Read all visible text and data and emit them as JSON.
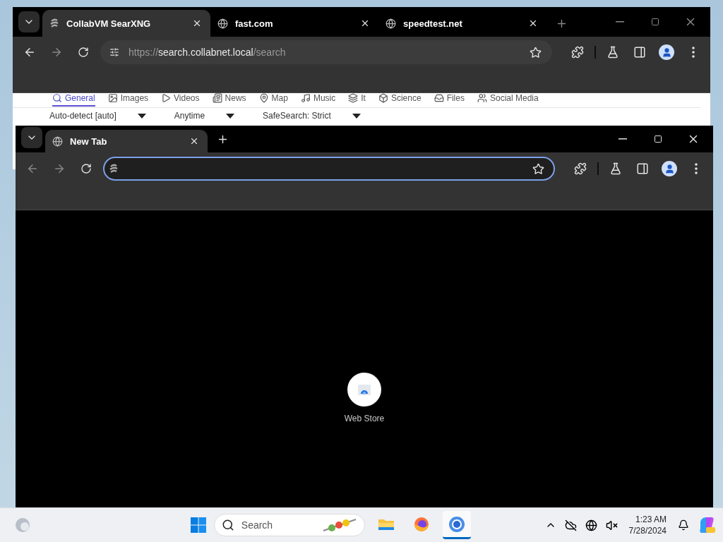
{
  "windows": [
    {
      "active": false,
      "tabs": [
        {
          "title": "CollabVM SearXNG",
          "kind": "site",
          "selected": true
        },
        {
          "title": "fast.com",
          "kind": "globe",
          "selected": false
        },
        {
          "title": "speedtest.net",
          "kind": "globe",
          "selected": false
        }
      ],
      "address": {
        "scheme": "https://",
        "host": "search.collabnet.local",
        "path": "/search",
        "focused": false
      },
      "page": {
        "kind": "search",
        "categories": [
          {
            "label": "General",
            "selected": true
          },
          {
            "label": "Images",
            "selected": false
          },
          {
            "label": "Videos",
            "selected": false
          },
          {
            "label": "News",
            "selected": false
          },
          {
            "label": "Map",
            "selected": false
          },
          {
            "label": "Music",
            "selected": false
          },
          {
            "label": "It",
            "selected": false
          },
          {
            "label": "Science",
            "selected": false
          },
          {
            "label": "Files",
            "selected": false
          },
          {
            "label": "Social Media",
            "selected": false
          }
        ],
        "filters": [
          "Auto-detect [auto]",
          "Anytime",
          "SafeSearch: Strict"
        ]
      }
    },
    {
      "active": true,
      "tabs": [
        {
          "title": "New Tab",
          "kind": "globe",
          "selected": true
        }
      ],
      "address": {
        "focused": true
      },
      "page": {
        "kind": "newtab",
        "shortcuts": [
          {
            "label": "Web Store"
          }
        ]
      }
    }
  ],
  "taskbar": {
    "search_placeholder": "Search",
    "apps": [
      {
        "kind": "files",
        "selected": false
      },
      {
        "kind": "firefox",
        "selected": false
      },
      {
        "kind": "chrome",
        "selected": true
      }
    ],
    "time": "1:23 AM",
    "date": "7/28/2024"
  }
}
